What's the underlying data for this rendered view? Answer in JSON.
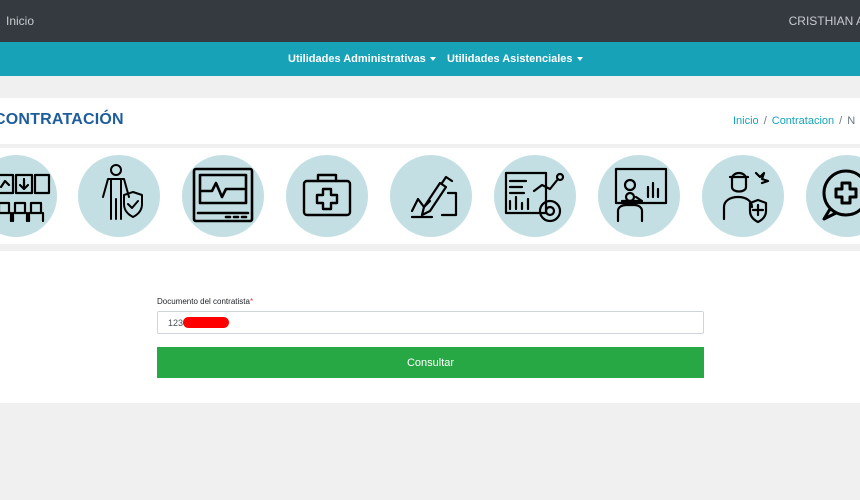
{
  "topbar": {
    "home_label": "Inicio",
    "user_name": "CRISTHIAN A"
  },
  "nav": {
    "menus": [
      {
        "label": "Utilidades Administrativas"
      },
      {
        "label": "Utilidades Asistenciales"
      }
    ]
  },
  "header": {
    "title": "CONTRATACIÓN",
    "breadcrumb": [
      "Inicio",
      "Contratacion",
      "N"
    ]
  },
  "icons": [
    "waiting-room-icon",
    "insured-person-icon",
    "monitor-icon",
    "first-aid-kit-icon",
    "signing-contract-icon",
    "analytics-dashboard-icon",
    "presentation-icon",
    "injured-patient-icon",
    "medical-chat-icon"
  ],
  "form": {
    "label": "Documento del contratista",
    "required_mark": "*",
    "input_value": "123",
    "submit_label": "Consultar"
  },
  "colors": {
    "topbar": "#343a40",
    "navbar": "#17a2b8",
    "title": "#1d5d9b",
    "icon_bg": "#c3dfe3",
    "button": "#28a745",
    "redaction": "#ff0000"
  }
}
